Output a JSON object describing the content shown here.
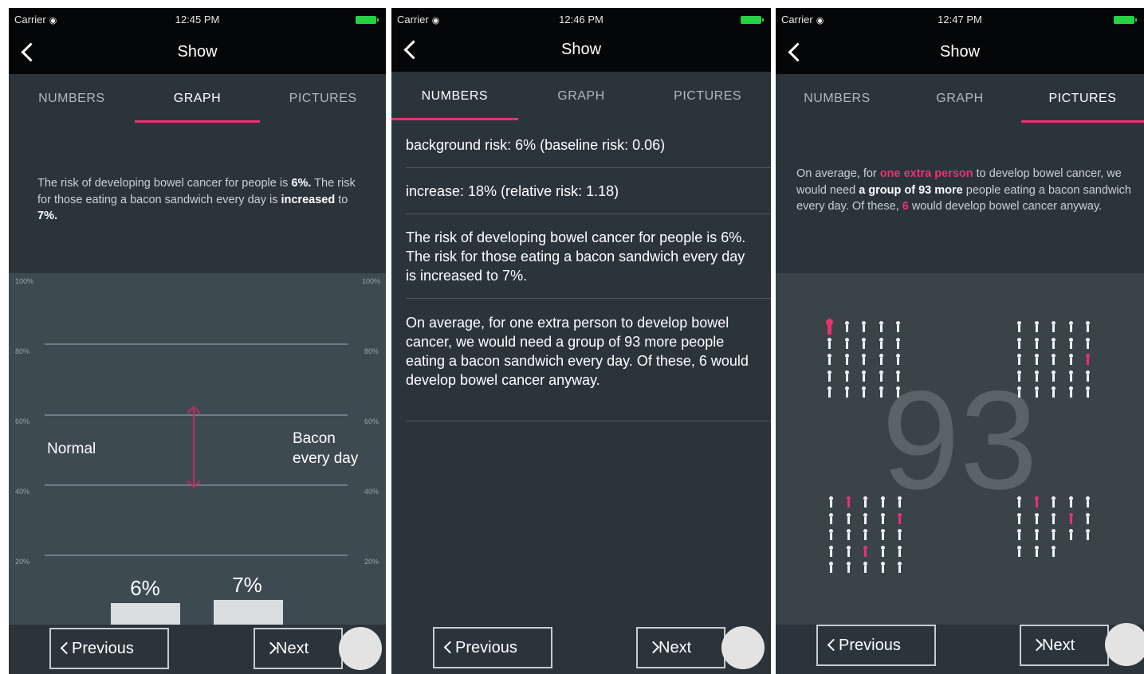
{
  "colors": {
    "background": "#2c343b",
    "bar": "#050607",
    "accent": "#e8336e",
    "graph_bg": "#3e4a52"
  },
  "screens": [
    {
      "status": {
        "carrier": "Carrier",
        "time": "12:45 PM"
      },
      "nav": {
        "title": "Show",
        "back_icon": "chevron-left-icon"
      },
      "tabs": [
        {
          "label": "NUMBERS",
          "active": false
        },
        {
          "label": "GRAPH",
          "active": true
        },
        {
          "label": "PICTURES",
          "active": false
        }
      ],
      "description": {
        "p1": "The risk of developing bowel cancer for people is ",
        "p2": "6%.",
        "p3": " The risk for those eating a bacon sandwich every day is ",
        "p4": "increased",
        "p5": " to ",
        "p6": "7%."
      },
      "graph": {
        "y_ticks": [
          "100%",
          "80%",
          "60%",
          "40%",
          "20%"
        ],
        "label_left": "Normal",
        "label_right": "Bacon every day",
        "bar_labels": [
          "6%",
          "7%"
        ]
      },
      "buttons": {
        "previous": "Previous",
        "next": "Next"
      }
    },
    {
      "status": {
        "carrier": "Carrier",
        "time": "12:46 PM"
      },
      "nav": {
        "title": "Show",
        "back_icon": "chevron-left-icon"
      },
      "tabs": [
        {
          "label": "NUMBERS",
          "active": true
        },
        {
          "label": "GRAPH",
          "active": false
        },
        {
          "label": "PICTURES",
          "active": false
        }
      ],
      "rows": [
        "background risk: 6% (baseline risk: 0.06)",
        "increase: 18% (relative risk: 1.18)",
        "The risk of developing bowel cancer for people is 6%. The risk for those eating a bacon sandwich every day is increased to 7%.",
        "On average, for one extra person to develop bowel cancer, we would need a group of 93 more people eating a bacon sandwich every day. Of these, 6 would develop bowel cancer anyway."
      ],
      "buttons": {
        "previous": "Previous",
        "next": "Next"
      }
    },
    {
      "status": {
        "carrier": "Carrier",
        "time": "12:47 PM"
      },
      "nav": {
        "title": "Show",
        "back_icon": "chevron-left-icon"
      },
      "tabs": [
        {
          "label": "NUMBERS",
          "active": false
        },
        {
          "label": "GRAPH",
          "active": false
        },
        {
          "label": "PICTURES",
          "active": true
        }
      ],
      "description": {
        "p1": "On average, for ",
        "p2": "one extra person",
        "p3": " to develop bowel cancer, we would need ",
        "p4": "a group of 93 more",
        "p5": " people eating a bacon sandwich every day. Of these, ",
        "p6": "6",
        "p7": " would develop bowel cancer anyway."
      },
      "pictograph": {
        "big_number": "93",
        "person_icon": "person-icon",
        "group_size": 93,
        "highlighted": 6,
        "extra_person": 1
      },
      "buttons": {
        "previous": "Previous",
        "next": "Next"
      }
    }
  ]
}
